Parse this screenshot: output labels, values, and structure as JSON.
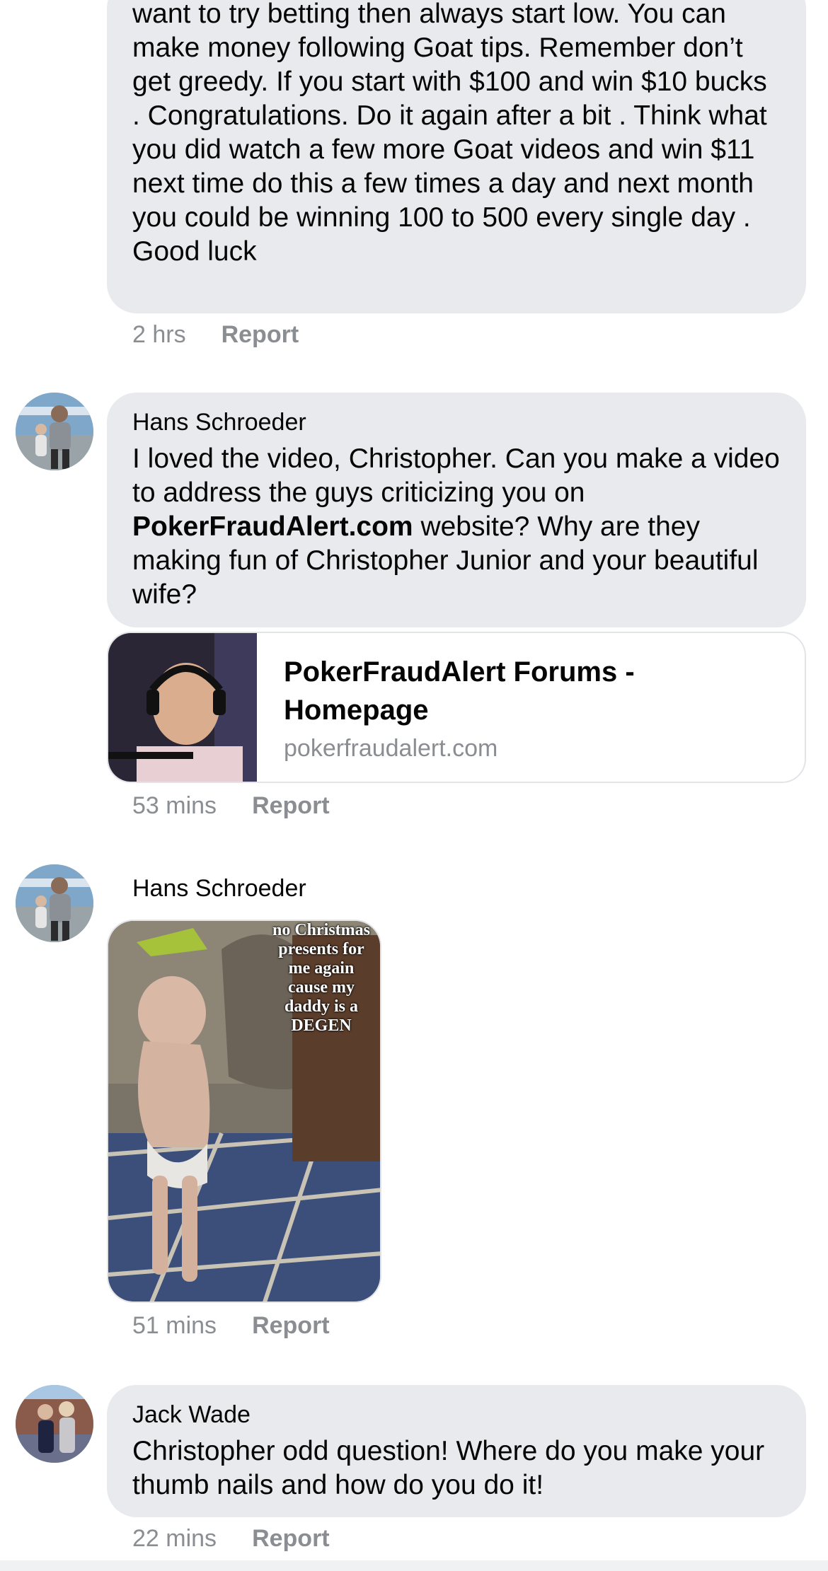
{
  "comments": [
    {
      "text": "want to try betting then always start low. You can make money following Goat tips. Remember don’t get greedy. If you start with $100 and win $10 bucks . Congratulations. Do it again after a bit . Think what you did watch a few more Goat videos and win $11 next time do this a few times a day and next month you could be winning 100 to 500 every single day . Good luck",
      "time": "2 hrs",
      "report": "Report"
    },
    {
      "author": "Hans Schroeder",
      "text_before": "I loved the video, Christopher. Can you make a video to address the guys criticizing you on ",
      "text_bold": "PokerFraudAlert.com",
      "text_after": " website? Why are they making fun of Christopher Junior and your beautiful wife?",
      "link": {
        "title": "PokerFraudAlert Forums - Homepage",
        "domain": "pokerfraudalert.com"
      },
      "time": "53 mins",
      "report": "Report"
    },
    {
      "author": "Hans Schroeder",
      "gif_caption": "no Christmas presents for me again cause my daddy is a DEGEN",
      "time": "51 mins",
      "report": "Report"
    },
    {
      "author": "Jack Wade",
      "text": "Christopher odd question! Where do you make your thumb nails and how do you do it!",
      "time": "22 mins",
      "report": "Report"
    }
  ],
  "colors": {
    "bubble": "#e9eaee",
    "meta": "#8a8d91",
    "text": "#050505"
  }
}
